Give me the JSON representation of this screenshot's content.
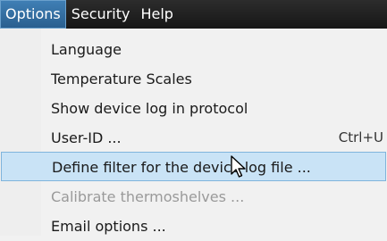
{
  "menubar": {
    "items": [
      {
        "label": "Options",
        "active": true
      },
      {
        "label": "Security",
        "active": false
      },
      {
        "label": "Help",
        "active": false
      }
    ]
  },
  "dropdown": {
    "items": [
      {
        "label": "Language",
        "shortcut": "",
        "state": "normal"
      },
      {
        "label": "Temperature Scales",
        "shortcut": "",
        "state": "normal"
      },
      {
        "label": "Show device log in protocol",
        "shortcut": "",
        "state": "normal"
      },
      {
        "label": "User-ID ...",
        "shortcut": "Ctrl+U",
        "state": "normal"
      },
      {
        "label": "Define filter for the device log file ...",
        "shortcut": "",
        "state": "highlighted"
      },
      {
        "label": "Calibrate thermoshelves ...",
        "shortcut": "",
        "state": "disabled"
      },
      {
        "label": "Email options ...",
        "shortcut": "",
        "state": "normal"
      }
    ]
  },
  "colors": {
    "menubar_bg": "#1f1f1f",
    "active_menu_bg": "#3470a6",
    "highlight_bg": "#c9e3f6",
    "highlight_border": "#7fb4dc",
    "disabled_text": "#9a9a9a"
  },
  "cursor": {
    "icon": "arrow-pointer-icon"
  }
}
